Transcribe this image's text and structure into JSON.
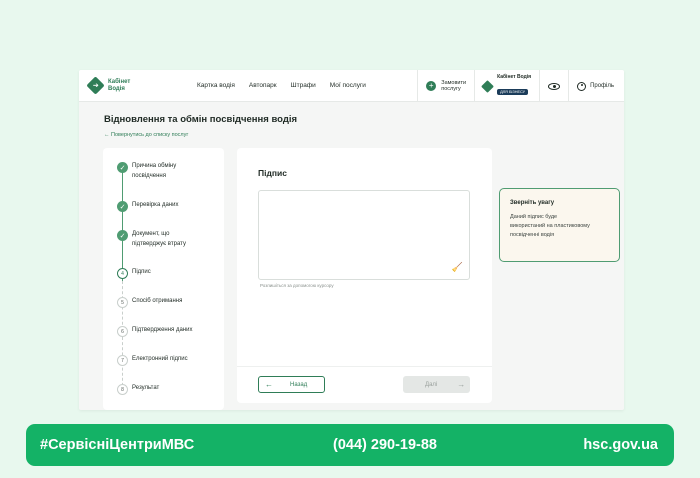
{
  "app": {
    "logo_text": "Кабінет\nВодія",
    "nav": [
      "Картка водія",
      "Автопарк",
      "Штрафи",
      "Мої послуги"
    ],
    "order_service": "Замовити\nпослугу",
    "cabinet_title": "Кабінет Водія",
    "cabinet_badge": "ДЛЯ БІЗНЕСУ",
    "profile": "Профіль"
  },
  "page": {
    "title": "Відновлення та обмін посвідчення водія",
    "back_link": "← Повернутись до списку послуг"
  },
  "steps": [
    {
      "label": "Причина обміну\nпосвідчення",
      "status": "done",
      "marker": "✓"
    },
    {
      "label": "Перевірка даних",
      "status": "done",
      "marker": "✓"
    },
    {
      "label": "Документ, що\nпідтверджує втрату",
      "status": "done",
      "marker": "✓"
    },
    {
      "label": "Підпис",
      "status": "active",
      "marker": "4"
    },
    {
      "label": "Спосіб отримання",
      "status": "todo",
      "marker": "5"
    },
    {
      "label": "Підтвердження даних",
      "status": "todo",
      "marker": "6"
    },
    {
      "label": "Електронний підпис",
      "status": "todo",
      "marker": "7"
    },
    {
      "label": "Результат",
      "status": "todo",
      "marker": "8"
    }
  ],
  "signature": {
    "title": "Підпис",
    "hint": "Розпишіться за допомогою курсору",
    "back_label": "Назад",
    "next_label": "Далі"
  },
  "notice": {
    "title": "Зверніть увагу",
    "text": "Даний підпис буде\nвикористаний на пластиковому\nпосвідченні водія"
  },
  "footer": {
    "hashtag": "#СервісніЦентриМВС",
    "phone": "(044) 290-19-88",
    "site": "hsc.gov.ua"
  },
  "colors": {
    "accent": "#2f7d57",
    "footer_bar": "#14b266",
    "background": "#e8f8ee"
  }
}
